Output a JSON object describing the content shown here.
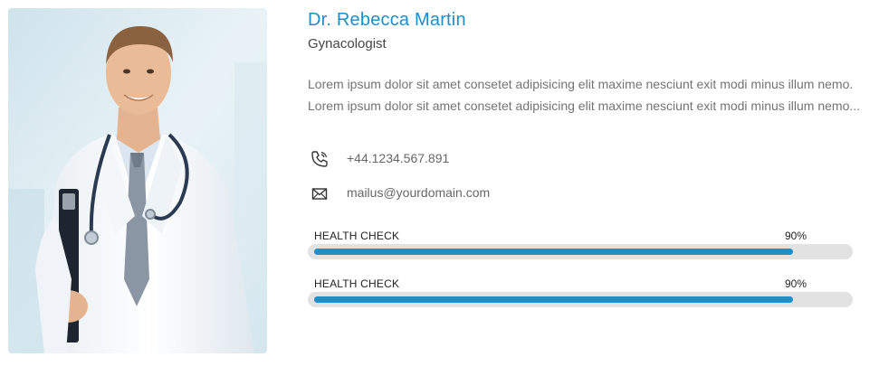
{
  "profile": {
    "name": "Dr. Rebecca Martin",
    "role": "Gynacologist",
    "bio": "Lorem ipsum dolor sit amet consetet adipisicing elit maxime nesciunt exit modi minus illum nemo. Lorem ipsum dolor sit amet consetet adipisicing elit maxime nesciunt exit modi minus illum nemo...",
    "photo_icon": "doctor-photo"
  },
  "contact": {
    "phone": "+44.1234.567.891",
    "phone_icon": "phone-icon",
    "email": "mailus@yourdomain.com",
    "email_icon": "envelope-icon"
  },
  "skills": [
    {
      "label": "HEALTH CHECK",
      "percent_label": "90%",
      "value": 0.9
    },
    {
      "label": "HEALTH CHECK",
      "percent_label": "90%",
      "value": 0.9
    }
  ],
  "colors": {
    "accent": "#1f8fc9",
    "name": "#1e8ec8",
    "track": "#e2e2e2"
  }
}
